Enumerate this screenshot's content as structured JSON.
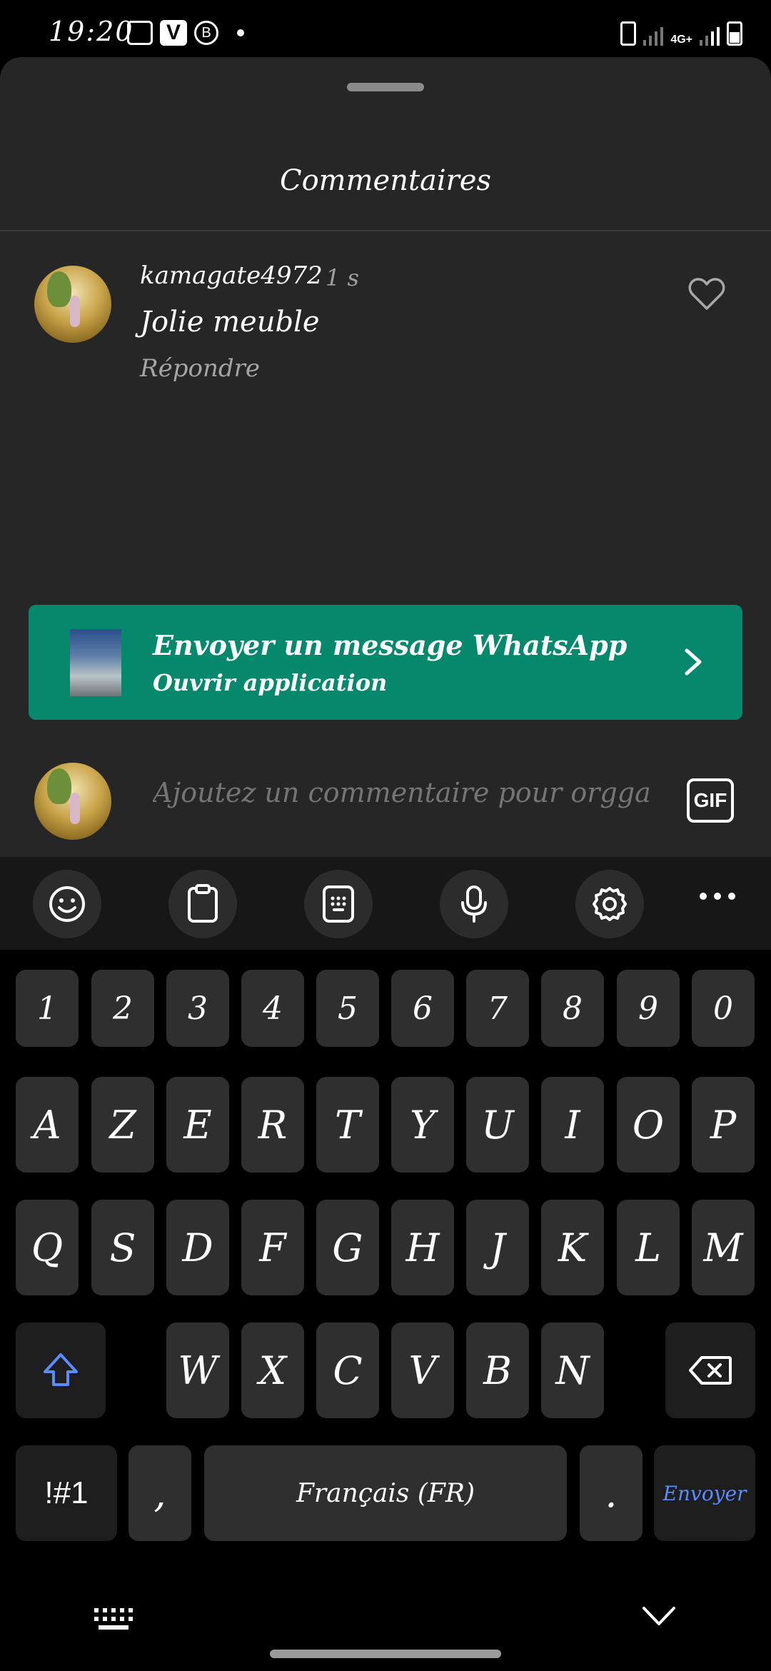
{
  "status_bar": {
    "time": "19:20",
    "left_icons": [
      "gallery-icon",
      "v-app-icon",
      "b-app-icon",
      "notification-dot-icon"
    ],
    "right_icons": [
      "battery-saver-icon",
      "signal-1-icon",
      "4g-icon",
      "signal-2-icon",
      "battery-icon"
    ],
    "network_label": "4G+"
  },
  "sheet": {
    "title": "Commentaires"
  },
  "comment": {
    "username": "kamagate4972",
    "time": "1 s",
    "text": "Jolie meuble",
    "reply_label": "Répondre"
  },
  "whatsapp_banner": {
    "title": "Envoyer un message WhatsApp",
    "subtitle": "Ouvrir application",
    "color": "#06886d"
  },
  "comment_input": {
    "placeholder": "Ajoutez un commentaire pour orggan",
    "gif_label": "GIF"
  },
  "keyboard": {
    "toolbar": [
      "emoji-icon",
      "clipboard-icon",
      "keypad-icon",
      "microphone-icon",
      "settings-icon",
      "more-icon"
    ],
    "number_row": [
      "1",
      "2",
      "3",
      "4",
      "5",
      "6",
      "7",
      "8",
      "9",
      "0"
    ],
    "row1": [
      "A",
      "Z",
      "E",
      "R",
      "T",
      "Y",
      "U",
      "I",
      "O",
      "P"
    ],
    "row2": [
      "Q",
      "S",
      "D",
      "F",
      "G",
      "H",
      "J",
      "K",
      "L",
      "M"
    ],
    "row3": [
      "W",
      "X",
      "C",
      "V",
      "B",
      "N"
    ],
    "symbols_label": "!#1",
    "comma_label": ",",
    "space_label": "Français (FR)",
    "period_label": ".",
    "send_label": "Envoyer",
    "accent_color": "#5a8cff"
  }
}
